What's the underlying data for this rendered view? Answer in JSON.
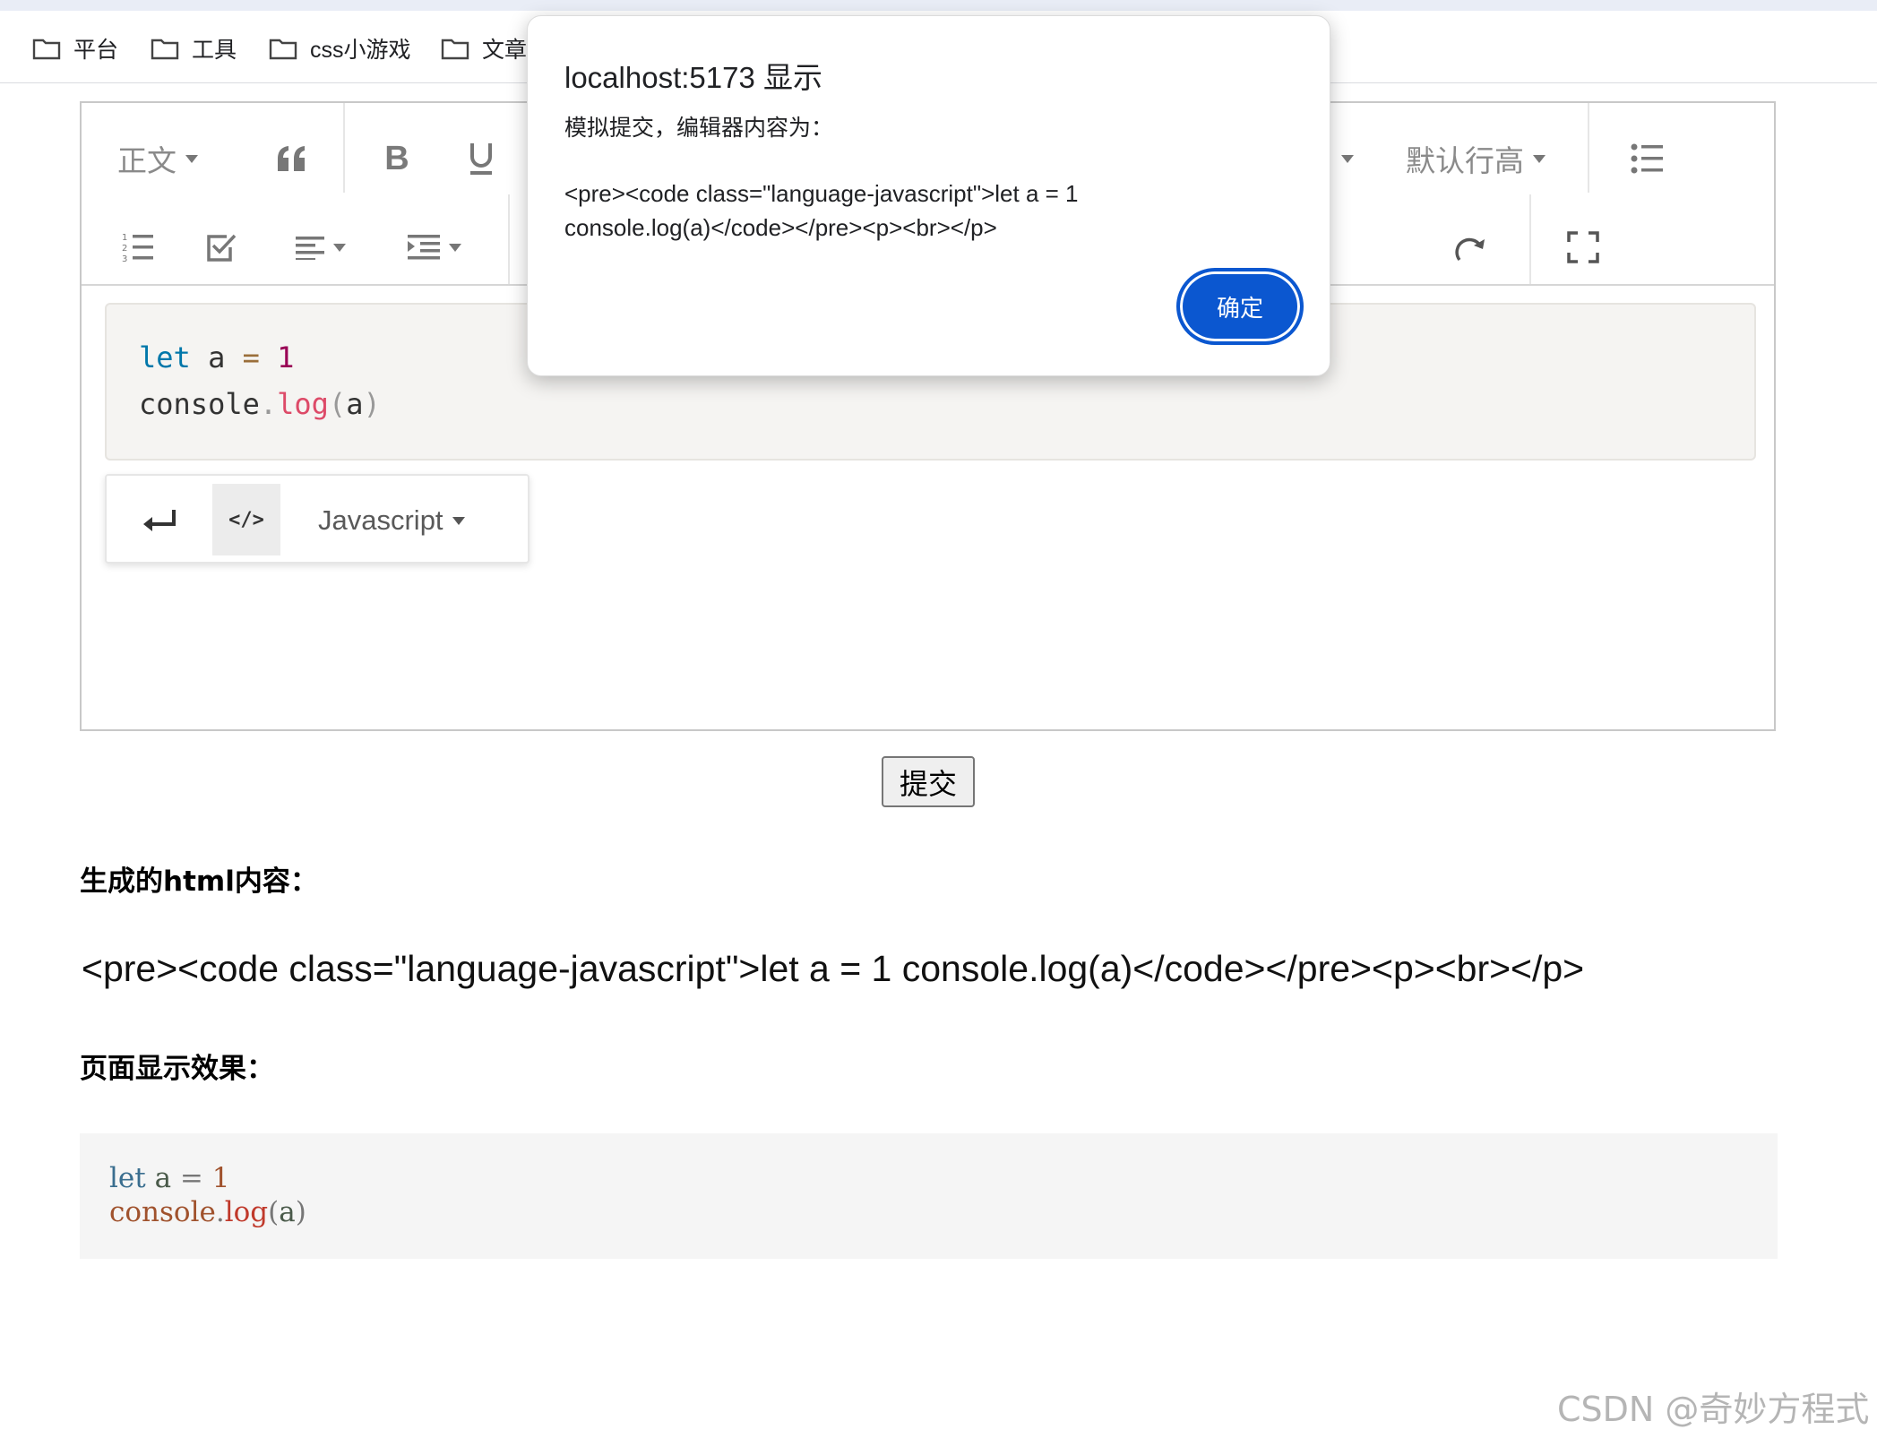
{
  "bookmarks": [
    "平台",
    "工具",
    "css小游戏",
    "文章"
  ],
  "toolbar": {
    "heading_label": "正文",
    "line_height_label": "默认行高",
    "language_label": "Javascript"
  },
  "editor_code": {
    "line1": {
      "kw": "let",
      "var": " a ",
      "op": "=",
      "num": " 1"
    },
    "line2": {
      "obj": "console",
      "dot": ".",
      "fn": "log",
      "open": "(",
      "arg": "a",
      "close": ")"
    }
  },
  "submit_label": "提交",
  "section_html_title": "生成的html内容：",
  "html_output": "<pre><code class=\"language-javascript\">let a = 1 console.log(a)</code></pre><p><br></p>",
  "section_effect_title": "页面显示效果：",
  "dialog": {
    "title": "localhost:5173 显示",
    "subtitle": "模拟提交，编辑器内容为：",
    "message": "<pre><code class=\"language-javascript\">let a = 1\nconsole.log(a)</code></pre><p><br></p>",
    "ok_label": "确定"
  },
  "watermark": "CSDN @奇妙方程式",
  "colors": {
    "accent": "#0b57d0",
    "code_bg": "#f5f4f2",
    "preview_bg": "#f5f5f5"
  }
}
